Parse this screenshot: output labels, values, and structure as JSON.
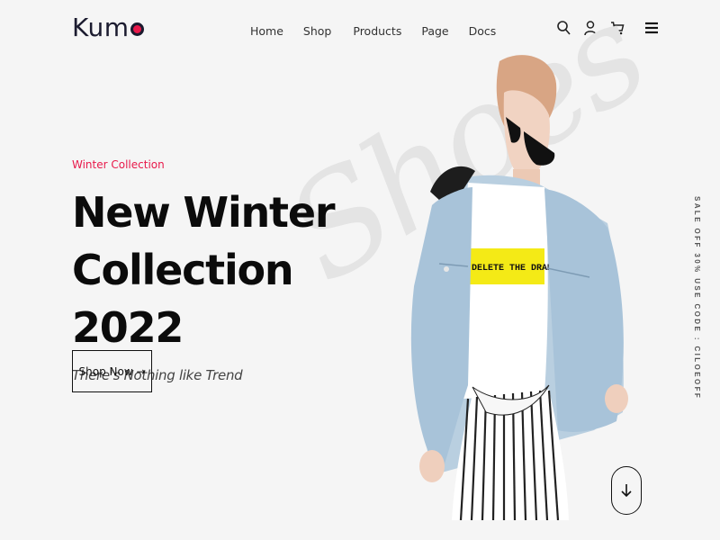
{
  "brand": {
    "name": "Kumo",
    "accent": "#e8194a",
    "dark": "#1b1b2f"
  },
  "nav": [
    "Home",
    "Shop",
    "Products",
    "Page",
    "Docs"
  ],
  "header_icons": [
    "search-icon",
    "user-icon",
    "cart-icon",
    "menu-icon"
  ],
  "hero": {
    "eyebrow": "Winter Collection",
    "title_line1": "New Winter",
    "title_line2": "Collection 2022",
    "subtitle": "There's Nothing like Trend",
    "cta": "Shop Now →",
    "watermark": "Shoes",
    "shirt_text": "DELETE THE DRAMA"
  },
  "side_promo": "SALE OFF 30% USE CODE : CILOEOFF",
  "scroll_icon": "arrow-down-icon"
}
